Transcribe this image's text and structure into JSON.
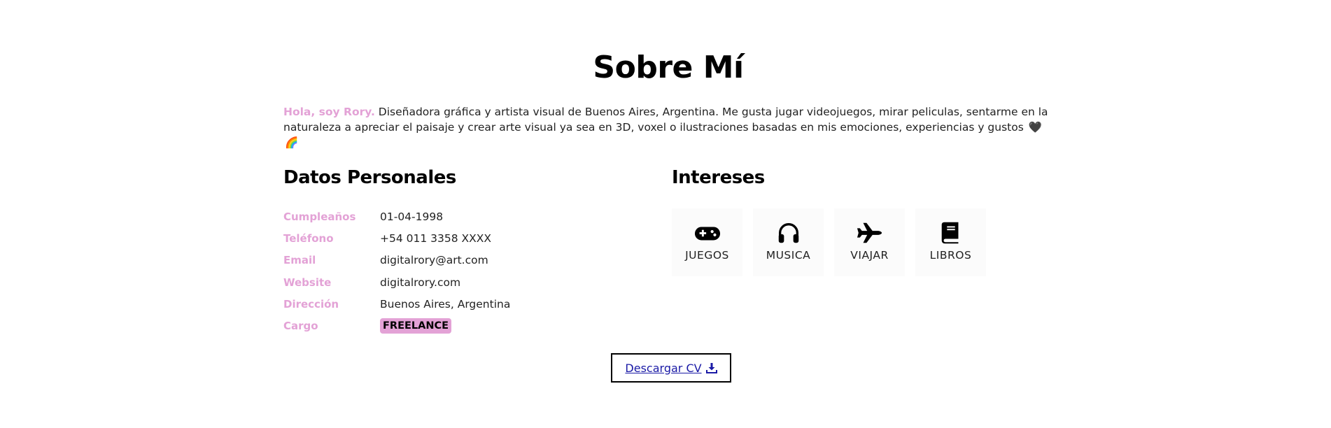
{
  "about": {
    "title": "Sobre Mí",
    "intro_highlight": "Hola, soy Rory.",
    "intro_text": "Diseñadora gráfica y artista visual de Buenos Aires, Argentina. Me gusta jugar videojuegos, mirar peliculas, sentarme en la naturaleza a apreciar el paisaje y crear arte visual ya sea en 3D, voxel o ilustraciones basadas en mis emociones, experiencias y gustos",
    "intro_emoji_1": "🖤",
    "intro_emoji_2": "🌈"
  },
  "personal": {
    "heading": "Datos Personales",
    "rows": [
      {
        "label": "Cumpleaños",
        "value": "01-04-1998"
      },
      {
        "label": "Teléfono",
        "value": "+54 011 3358 XXXX"
      },
      {
        "label": "Email",
        "value": "digitalrory@art.com"
      },
      {
        "label": "Website",
        "value": "digitalrory.com"
      },
      {
        "label": "Dirección",
        "value": "Buenos Aires, Argentina"
      },
      {
        "label": "Cargo",
        "value": "FREELANCE"
      }
    ]
  },
  "interests": {
    "heading": "Intereses",
    "items": [
      {
        "label": "JUEGOS",
        "icon": "gamepad-icon"
      },
      {
        "label": "MUSICA",
        "icon": "headphones-icon"
      },
      {
        "label": "VIAJAR",
        "icon": "plane-icon"
      },
      {
        "label": "LIBROS",
        "icon": "book-icon"
      }
    ]
  },
  "cv_button": {
    "label": "Descargar CV",
    "icon": "download-icon"
  },
  "colors": {
    "accent": "#e3a2d6",
    "text": "#222222",
    "heading": "#000000",
    "link": "#1a1aa6"
  }
}
